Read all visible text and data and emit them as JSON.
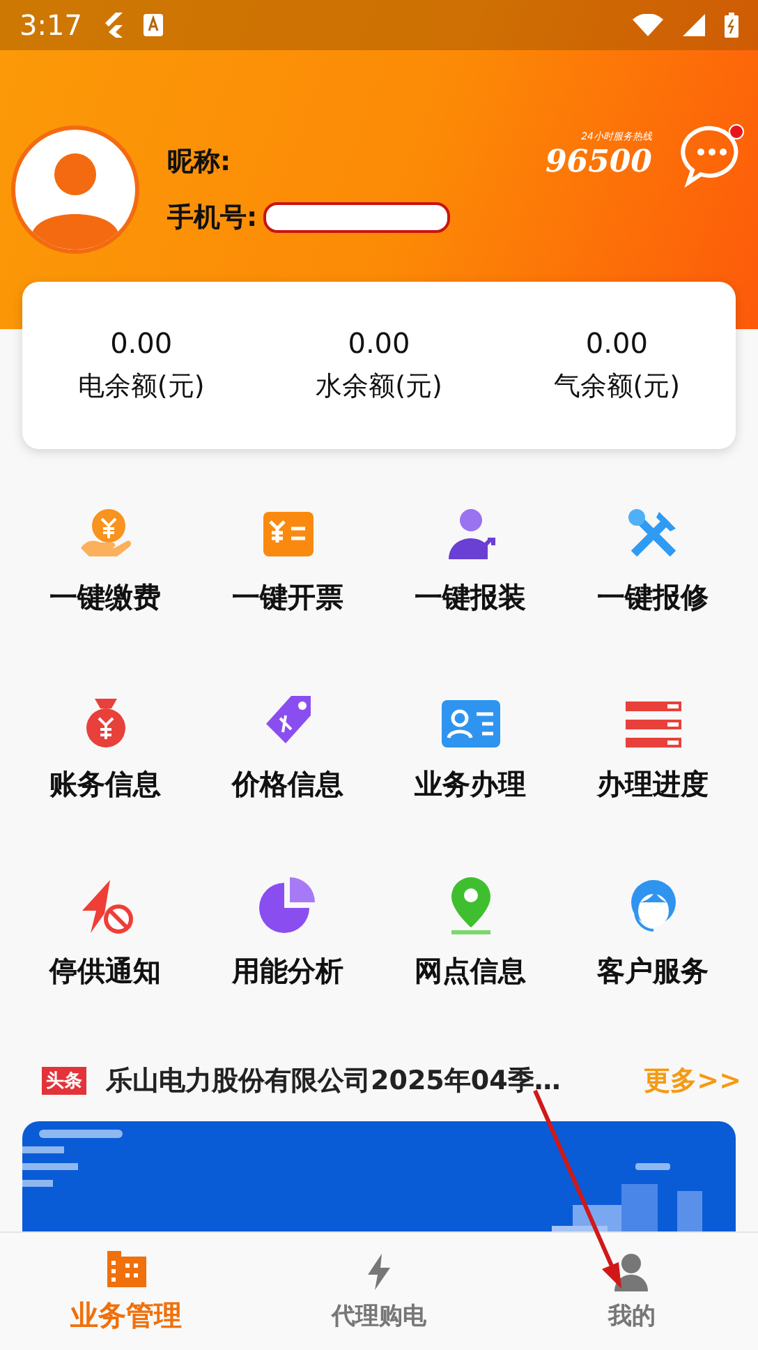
{
  "status_bar": {
    "time": "3:17"
  },
  "header": {
    "nickname_label": "昵称:",
    "phone_label": "手机号:",
    "hotline": {
      "caption": "24小时服务热线",
      "number": "96500"
    },
    "messages": {
      "unread": true
    }
  },
  "balances": [
    {
      "value": "0.00",
      "label": "电余额(元)"
    },
    {
      "value": "0.00",
      "label": "水余额(元)"
    },
    {
      "value": "0.00",
      "label": "气余额(元)"
    }
  ],
  "services": [
    {
      "kind": "pay",
      "label": "一键缴费"
    },
    {
      "kind": "invoice",
      "label": "一键开票"
    },
    {
      "kind": "install",
      "label": "一键报装"
    },
    {
      "kind": "repair",
      "label": "一键报修"
    },
    {
      "kind": "bill",
      "label": "账务信息"
    },
    {
      "kind": "price",
      "label": "价格信息"
    },
    {
      "kind": "business",
      "label": "业务办理"
    },
    {
      "kind": "progress",
      "label": "办理进度"
    },
    {
      "kind": "outage",
      "label": "停供通知"
    },
    {
      "kind": "analysis",
      "label": "用能分析"
    },
    {
      "kind": "location",
      "label": "网点信息"
    },
    {
      "kind": "service",
      "label": "客户服务"
    }
  ],
  "news": {
    "badge": "头条",
    "headline": "乐山电力股份有限公司2025年04季…",
    "more": "更多>>"
  },
  "tabs": [
    {
      "kind": "building",
      "label": "业务管理",
      "selected": true
    },
    {
      "kind": "bolt",
      "label": "代理购电",
      "selected": false
    },
    {
      "kind": "person",
      "label": "我的",
      "selected": false
    }
  ]
}
